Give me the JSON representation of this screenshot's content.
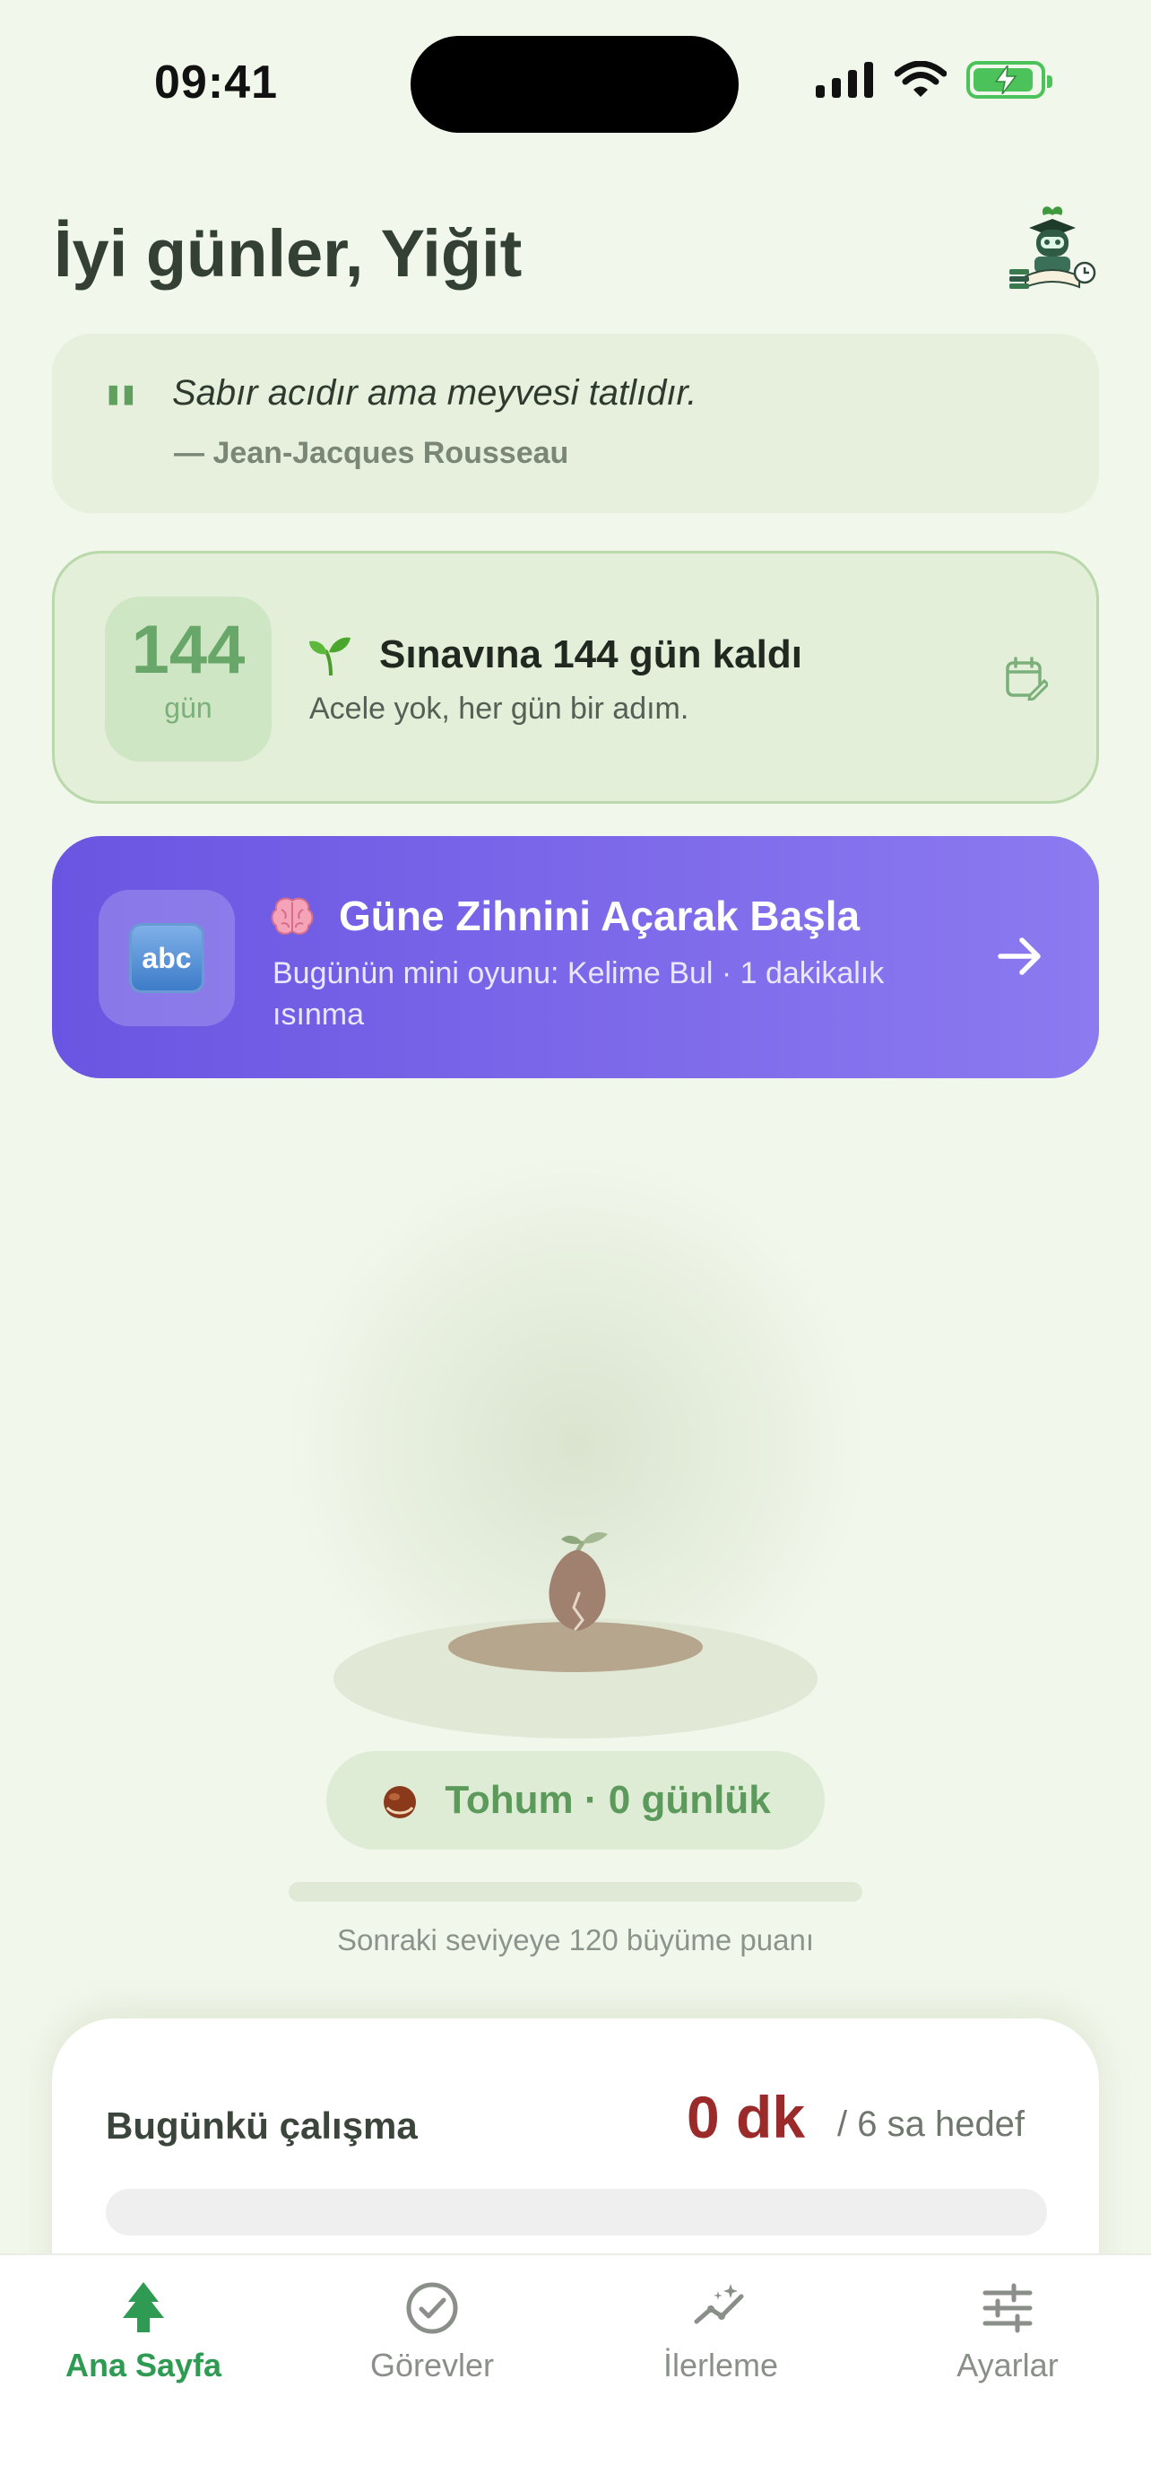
{
  "status_bar": {
    "time": "09:41"
  },
  "header": {
    "greeting": "İyi günler, Yiğit",
    "mascot_icon": "robot-graduate-mascot-icon"
  },
  "quote": {
    "text": "Sabır acıdır ama meyvesi tatlıdır.",
    "author": "— Jean-Jacques Rousseau"
  },
  "exam": {
    "days_number": "144",
    "days_unit": "gün",
    "title": "Sınavına 144 gün kaldı",
    "subtitle": "Acele yok, her gün bir adım.",
    "icon": "seedling-icon",
    "edit_icon": "calendar-edit-icon"
  },
  "game": {
    "badge": "abc",
    "title": "Güne Zihnini Açarak Başla",
    "subtitle": "Bugünün mini oyunu: Kelime Bul · 1 dakikalık ısınma",
    "icon": "brain-icon"
  },
  "growth": {
    "stage_label": "Tohum · 0 günlük",
    "progress_fraction": 0.0,
    "next_level_text": "Sonraki seviyeye 120 büyüme puanı"
  },
  "today": {
    "label": "Bugünkü çalışma",
    "value": "0 dk",
    "goal": "/ 6 sa hedef",
    "progress_fraction": 0.0
  },
  "tabs": [
    {
      "label": "Ana Sayfa",
      "icon": "tree-icon",
      "active": true
    },
    {
      "label": "Görevler",
      "icon": "check-circle-icon",
      "active": false
    },
    {
      "label": "İlerleme",
      "icon": "sparkle-chart-icon",
      "active": false
    },
    {
      "label": "Ayarlar",
      "icon": "sliders-icon",
      "active": false
    }
  ],
  "colors": {
    "background": "#f2f7ec",
    "accent_green": "#2e9a52",
    "game_gradient_start": "#6a55e2",
    "game_gradient_end": "#8c7af0",
    "today_value": "#9b2a2a"
  }
}
